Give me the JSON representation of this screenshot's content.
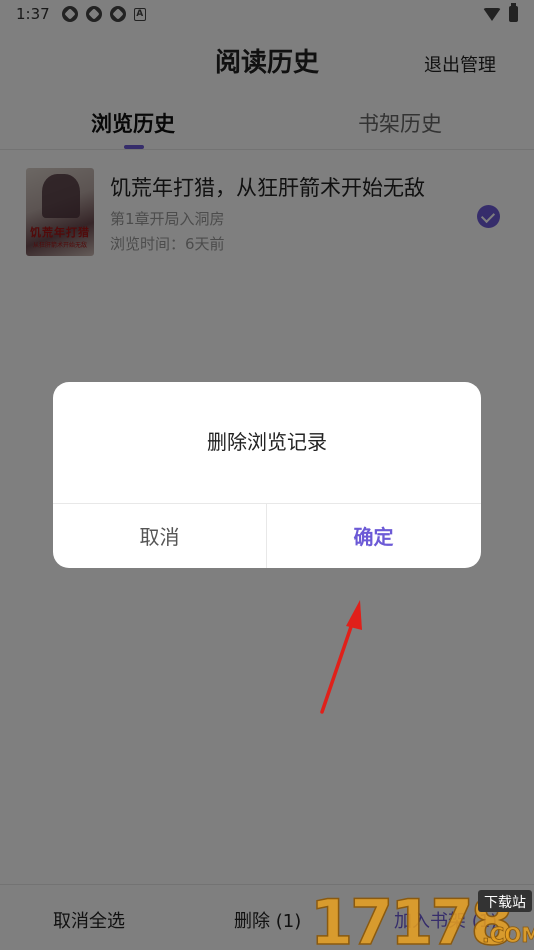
{
  "status_bar": {
    "time": "1:37",
    "icons": [
      "app-icon",
      "app-icon",
      "app-icon",
      "a-icon",
      "wifi-icon",
      "battery-icon"
    ]
  },
  "header": {
    "title": "阅读历史",
    "exit_manage": "退出管理"
  },
  "tabs": [
    {
      "label": "浏览历史",
      "active": true
    },
    {
      "label": "书架历史",
      "active": false
    }
  ],
  "books": [
    {
      "cover_title": "饥荒年打猎",
      "cover_subtitle": "从狂肝箭术开始无敌",
      "title": "饥荒年打猎，从狂肝箭术开始无敌",
      "chapter": "第1章开局入洞房",
      "browse_time": "浏览时间：6天前",
      "selected": true
    }
  ],
  "bottom_bar": {
    "deselect_all": "取消全选",
    "delete": "删除 (1)",
    "add_to_shelf": "加入书架 (1)"
  },
  "dialog": {
    "title": "删除浏览记录",
    "cancel": "取消",
    "confirm": "确定"
  },
  "watermark": {
    "text": "17178",
    "tag": "下载站",
    "domain": ".COM"
  },
  "colors": {
    "accent": "#6c5ad6",
    "overlay": "rgba(0,0,0,0.5)",
    "arrow": "#e0201a"
  }
}
